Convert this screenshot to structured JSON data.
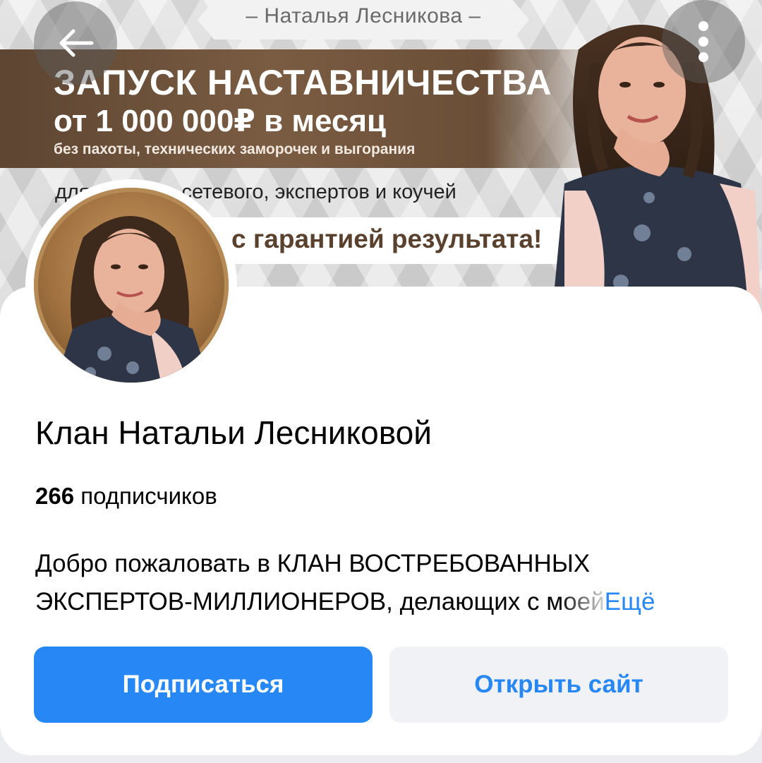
{
  "cover": {
    "author": "– Наталья Лесникова –",
    "headline_line1": "ЗАПУСК НАСТАВНИЧЕСТВА",
    "headline_line2": "от 1 000 000₽ в месяц",
    "headline_line3": "без пахоты, технических заморочек и выгорания",
    "audience": "для лидеров сетевого, экспертов и коучей",
    "guarantee": "с гарантией результата!"
  },
  "header": {
    "back_icon": "arrow-left-icon",
    "menu_icon": "more-vertical-icon"
  },
  "profile": {
    "title": "Клан Натальи Лесниковой",
    "subscribers_count": "266",
    "subscribers_label": " подписчиков",
    "description_line1": "Добро пожаловать в КЛАН ВОСТРЕБОВАННЫХ",
    "description_line2_main": "ЭКСПЕРТОВ-МИЛЛИОНЕРОВ, делающих ",
    "description_line2_fade": "с моей",
    "more_label": "Ещё"
  },
  "actions": {
    "subscribe_label": "Подписаться",
    "open_site_label": "Открыть сайт"
  },
  "colors": {
    "accent": "#2787f5",
    "secondary_button_bg": "#f0f2f5",
    "banner_brown": "#6a4e37"
  }
}
